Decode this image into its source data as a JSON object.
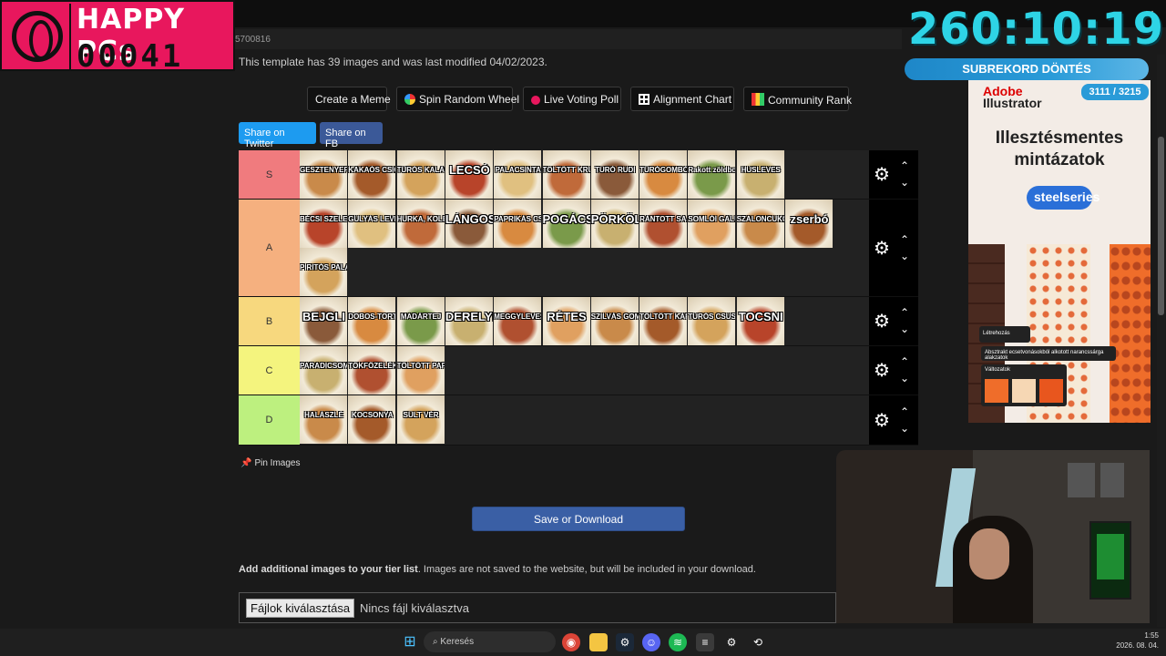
{
  "url_fragment": "5700816",
  "template_info": "This template has 39 images and was last modified 04/02/2023.",
  "toolbar": {
    "create_meme": "Create a Meme",
    "spin_wheel": "Spin Random Wheel",
    "voting_poll": "Live Voting Poll",
    "alignment_chart": "Alignment Chart",
    "community_rank": "Community Rank"
  },
  "share": {
    "twitter": "Share on Twitter",
    "fb": "Share on FB"
  },
  "tiers": [
    {
      "label": "S",
      "color": "#f07b7e",
      "items": [
        "GESZTENYEPÜRÉ",
        "KAKAÓS CSIGA",
        "TÚRÓS KALÁCS",
        "LECSÓ",
        "PALACSINTA",
        "TÖLTÖTT KRUMPLI",
        "TÚRÓ RUDI",
        "TÚRÓGOMBÓC",
        "Rakott zöldborsófőzelék",
        "HÚSLEVES"
      ]
    },
    {
      "label": "A",
      "color": "#f5b07f",
      "items": [
        "BÉCSI SZELET",
        "GULYÁS LEVES",
        "HURKA, KOLBÁSZ",
        "LÁNGOS",
        "PAPRIKÁS CSIRKE",
        "POGÁCSA",
        "PÖRKÖLT",
        "RÁNTOTT SAJT",
        "SOMLÓI GALUSKA",
        "SZALONCUKOR",
        "zserbó",
        "PIRITÓS PALACSINTA"
      ]
    },
    {
      "label": "B",
      "color": "#f7d87e",
      "items": [
        "BEJGLI",
        "DOBOS-TORTA",
        "MADÁRTEJ",
        "DERELYE",
        "MEGGYLEVES",
        "RÉTES",
        "SZILVÁS GOMBÓC",
        "TÖLTÖTT KÁPOSZTA",
        "TÚRÓS CSUSZA",
        "TOCSNI"
      ]
    },
    {
      "label": "C",
      "color": "#f4f47e",
      "items": [
        "PARADICSOMOS KÁPOSZTA",
        "TÖKFŐZELÉK",
        "TÖLTÖTT PAPRIKA"
      ]
    },
    {
      "label": "D",
      "color": "#bdf07f",
      "items": [
        "HALÁSZLÉ",
        "KOCSONYA",
        "SÜLT VÉR"
      ]
    }
  ],
  "pin_images": "Pin Images",
  "save_download": "Save or Download",
  "additional_bold": "Add additional images to your tier list",
  "additional_rest": ". Images are not saved to the website, but will be included in your download.",
  "file_button": "Fájlok kiválasztása",
  "file_status": "Nincs fájl kiválasztva",
  "overlay": {
    "title": "HAPPY PCs",
    "count": "00041",
    "timer": "260:10:19",
    "subbar": "SUBREKORD DÖNTÉS"
  },
  "ad": {
    "brand": "Adobe",
    "product": "Illustrator",
    "counter": "3111 / 3215",
    "headline_1": "Illesztésmentes",
    "headline_2": "mintázatok",
    "sponsor": "steelseries",
    "panel_create": "Létrehozás",
    "panel_prompt": "Absztrakt ecsetvonásokból alkotott narancssárga alakzatok",
    "panel_variants": "Változatok"
  },
  "taskbar": {
    "search": "Keresés",
    "time": "1:55",
    "date": "2026. 08. 04."
  }
}
